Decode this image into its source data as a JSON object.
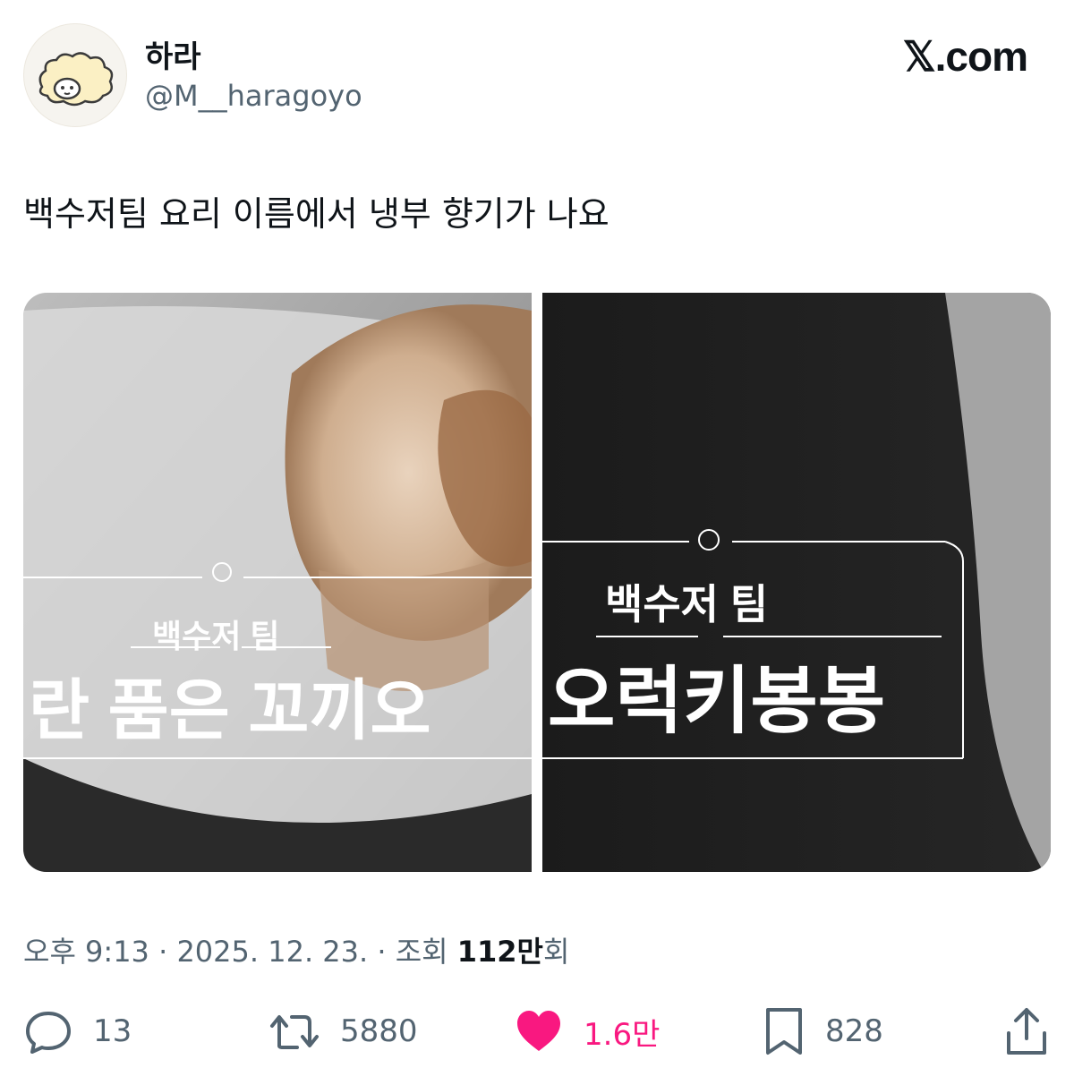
{
  "user": {
    "display_name": "하라",
    "handle": "@M__haragoyo",
    "avatar_icon": "sheep-avatar-icon"
  },
  "brand": {
    "logo_text": "𝕏.com"
  },
  "tweet": {
    "text": "백수저팀 요리 이름에서 냉부 향기가 나요"
  },
  "media": {
    "left_caption": {
      "team": "백수저 팀",
      "dish": "란 품은 꼬끼오"
    },
    "right_caption": {
      "team": "백수저 팀",
      "dish": "오럭키봉봉"
    }
  },
  "meta": {
    "time": "오후 9:13",
    "separator": "·",
    "date": "2025. 12. 23.",
    "views_label": "조회",
    "views_count": "112만",
    "views_suffix": "회"
  },
  "actions": {
    "reply": {
      "icon": "reply-icon",
      "count": "13"
    },
    "repost": {
      "icon": "repost-icon",
      "count": "5880"
    },
    "like": {
      "icon": "heart-icon",
      "count": "1.6만",
      "color": "#f91880"
    },
    "bookmark": {
      "icon": "bookmark-icon",
      "count": "828"
    },
    "share": {
      "icon": "share-icon"
    }
  }
}
